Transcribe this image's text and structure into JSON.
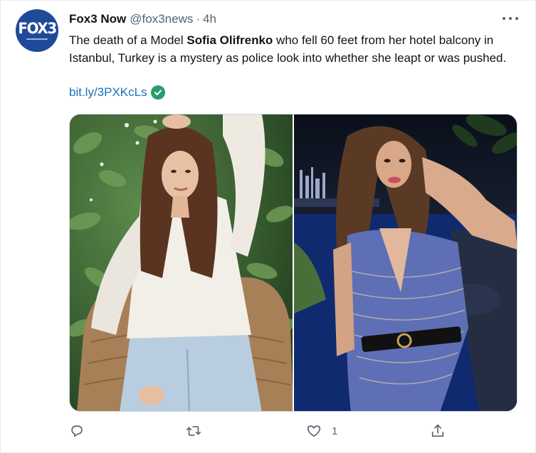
{
  "tweet": {
    "avatar": {
      "logo_text": "FOX3",
      "brand_color": "#1f4a9a"
    },
    "author_name": "Fox3 Now",
    "author_handle": "@fox3news",
    "separator": "·",
    "time": "4h",
    "text_before": "The death of a Model ",
    "text_bold": "Sofia Olifrenko",
    "text_after": " who fell 60 feet from her hotel balcony in Istanbul, Turkey is a mystery as police look into whether she leapt or was pushed.",
    "link": "bit.ly/3PXKcLs",
    "link_badge_icon": "verified-check-icon",
    "media": [
      {
        "name": "photo-left",
        "description_icon": "woman-white-shirt-photo"
      },
      {
        "name": "photo-right",
        "description_icon": "woman-night-swimsuit-photo"
      }
    ],
    "actions": {
      "reply_icon": "reply-icon",
      "retweet_icon": "retweet-icon",
      "like_icon": "like-icon",
      "like_count": "1",
      "share_icon": "share-icon"
    },
    "colors": {
      "text": "#0f1419",
      "secondary": "#536471",
      "link": "#1d6fb8",
      "verified": "#2a9d6c"
    }
  }
}
